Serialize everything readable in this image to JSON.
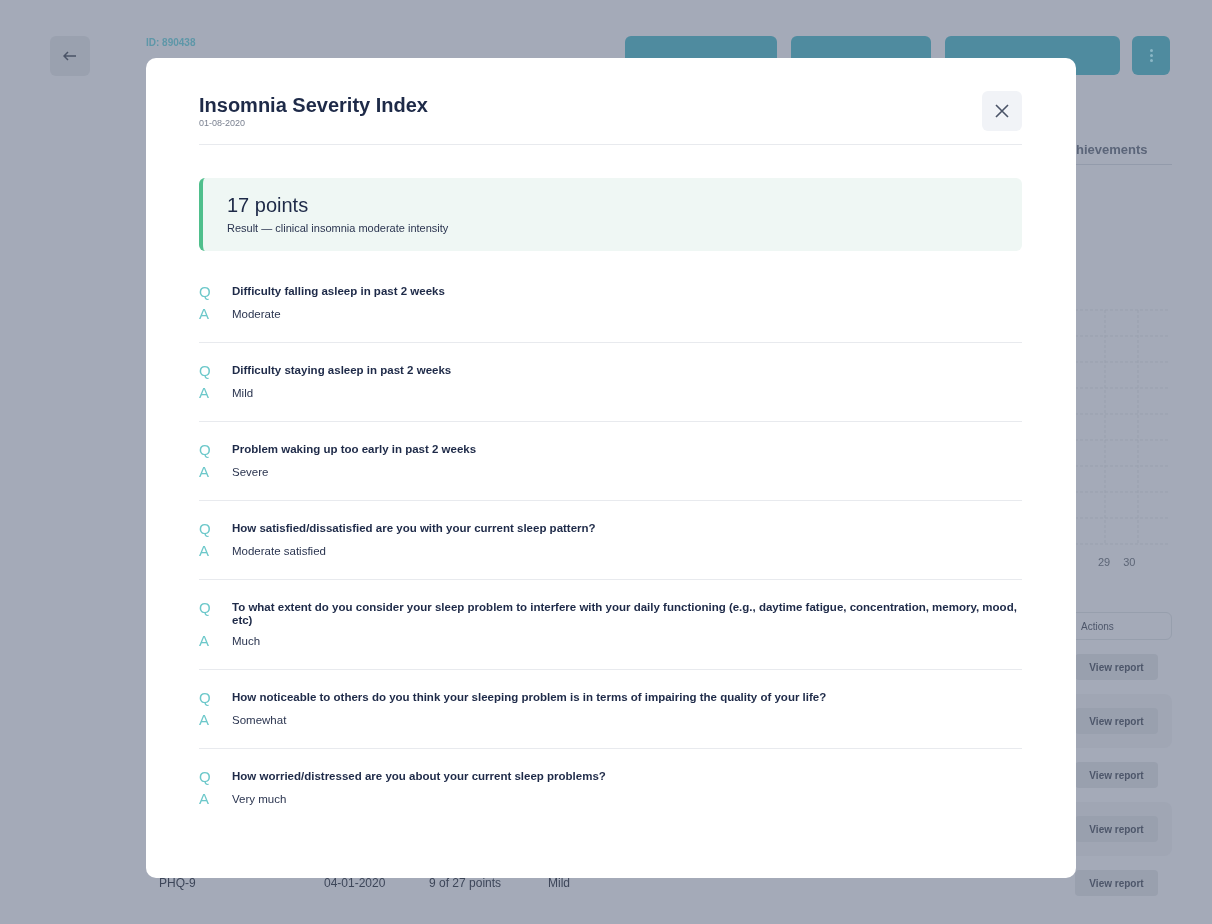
{
  "background": {
    "patient_id": "ID: 890438",
    "tab": "hievements",
    "chart_labels": [
      "29",
      "30"
    ],
    "table": {
      "actions_header": "Actions",
      "rows": [
        {
          "button": "View report"
        },
        {
          "button": "View report"
        },
        {
          "button": "View report"
        },
        {
          "button": "View report"
        },
        {
          "cells": [
            "PHQ-9",
            "04-01-2020",
            "9 of 27 points",
            "Mild"
          ],
          "button": "View report"
        }
      ]
    }
  },
  "modal": {
    "title": "Insomnia Severity Index",
    "date": "01-08-2020",
    "score": "17 points",
    "result": "Result — clinical insomnia moderate intensity",
    "items": [
      {
        "q_marker": "Q",
        "question": "Difficulty falling asleep in past 2 weeks",
        "a_marker": "A",
        "answer": "Moderate"
      },
      {
        "q_marker": "Q",
        "question": "Difficulty staying asleep in past 2 weeks",
        "a_marker": "A",
        "answer": "Mild"
      },
      {
        "q_marker": "Q",
        "question": "Problem waking up too early in past 2 weeks",
        "a_marker": "A",
        "answer": "Severe"
      },
      {
        "q_marker": "Q",
        "question": "How satisfied/dissatisfied are you with your current sleep pattern?",
        "a_marker": "A",
        "answer": "Moderate satisfied"
      },
      {
        "q_marker": "Q",
        "question": "To what extent do you consider your sleep problem to interfere with your daily functioning (e.g., daytime fatigue, concentration, memory, mood, etc)",
        "a_marker": "A",
        "answer": "Much"
      },
      {
        "q_marker": "Q",
        "question": "How noticeable to others do you think your sleeping problem is in terms of impairing the quality of your life?",
        "a_marker": "A",
        "answer": "Somewhat"
      },
      {
        "q_marker": "Q",
        "question": "How worried/distressed are you about your current sleep problems?",
        "a_marker": "A",
        "answer": "Very much"
      }
    ]
  }
}
